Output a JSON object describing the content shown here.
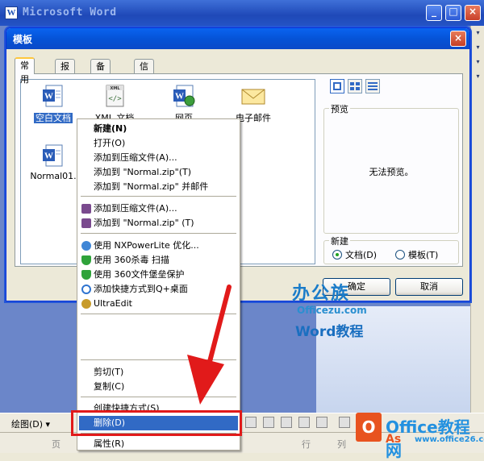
{
  "app": {
    "title": "Microsoft Word",
    "icon": "word-icon",
    "window_controls": [
      "_",
      "□",
      "×"
    ]
  },
  "dialog": {
    "title": "模板",
    "close_label": "×",
    "tabs": [
      {
        "label": "常用",
        "active": true
      },
      {
        "label": "报告",
        "active": false
      },
      {
        "label": "备忘录",
        "active": false
      },
      {
        "label": "信函和传真",
        "active": false
      }
    ],
    "files": [
      {
        "label": "空白文档",
        "icon": "word-doc-icon",
        "selected": true
      },
      {
        "label": "XML 文档",
        "icon": "xml-doc-icon",
        "selected": false
      },
      {
        "label": "网页",
        "icon": "web-page-icon",
        "selected": false
      },
      {
        "label": "电子邮件",
        "icon": "email-icon",
        "selected": false
      },
      {
        "label": "Normal01.",
        "icon": "word-doc-icon",
        "selected": false
      }
    ],
    "view_buttons": [
      "large-icons-icon",
      "list-view-icon",
      "details-view-icon"
    ],
    "preview": {
      "label": "预览",
      "text": "无法预览。"
    },
    "new_group": {
      "label": "新建",
      "options": [
        {
          "label": "文档(D)",
          "checked": true
        },
        {
          "label": "模板(T)",
          "checked": false
        }
      ]
    },
    "ok_label": "确定",
    "cancel_label": "取消"
  },
  "context_menu": {
    "items": [
      {
        "label": "新建(N)",
        "bold": true
      },
      {
        "label": "打开(O)"
      },
      {
        "label": "添加到压缩文件(A)..."
      },
      {
        "label": "添加到 \"Normal.zip\"(T)"
      },
      {
        "label": "添加到 \"Normal.zip\" 并邮件"
      },
      {
        "label": "添加到压缩文件(A)...",
        "icon": "winrar-icon"
      },
      {
        "label": "添加到 \"Normal.zip\" (T)",
        "icon": "winrar-icon"
      },
      {
        "label": "使用 NXPowerLite 优化...",
        "icon": "nxpowerlite-icon"
      },
      {
        "label": "使用 360杀毒 扫描",
        "icon": "shield-icon"
      },
      {
        "label": "使用 360文件堡垒保护",
        "icon": "shield-icon"
      },
      {
        "label": "添加快捷方式到Q+桌面",
        "icon": "qplus-icon"
      },
      {
        "label": "UltraEdit",
        "icon": "ultraedit-icon"
      },
      {
        "label": "剪切(T)"
      },
      {
        "label": "复制(C)"
      },
      {
        "label": "创建快捷方式(S)"
      },
      {
        "label": "删除(D)",
        "highlight": true
      },
      {
        "label": "属性(R)"
      }
    ]
  },
  "toolbar": {
    "draw_label": "绘图(D) ▾"
  },
  "status_bar": {
    "page_label": "页",
    "row_label": "行",
    "col_label": "列"
  },
  "watermark": {
    "brand_cn": "办公族",
    "site": "Officezu.com",
    "word_label": "Word教程",
    "office_text": "Office教程网",
    "office_sub": "As",
    "office_url": "www.office26.com"
  },
  "colors": {
    "highlight": "#316AC5",
    "arrow": "#E11A1A",
    "titlebar": "#0553D7"
  }
}
